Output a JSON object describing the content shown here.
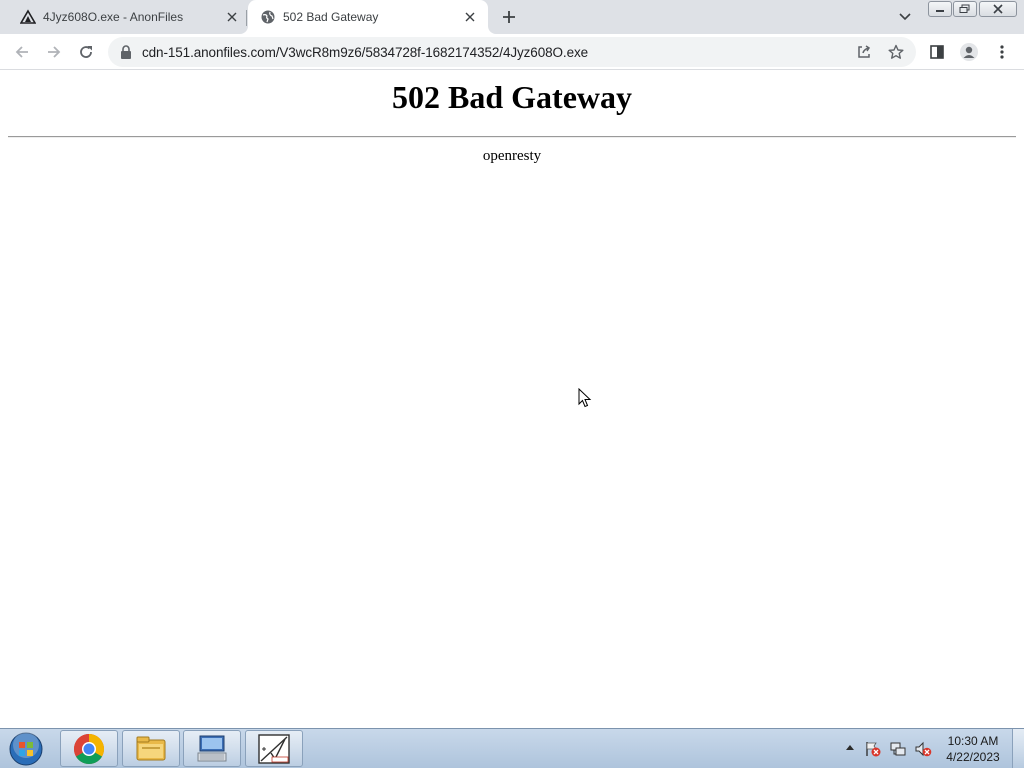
{
  "browser": {
    "tabs": [
      {
        "title": "4Jyz608O.exe - AnonFiles",
        "favicon": "anonfiles-logo-icon",
        "active": false
      },
      {
        "title": "502 Bad Gateway",
        "favicon": "globe-icon",
        "active": true
      }
    ],
    "address_bar": {
      "url": "cdn-151.anonfiles.com/V3wcR8m9z6/5834728f-1682174352/4Jyz608O.exe"
    }
  },
  "page": {
    "title": "502 Bad Gateway",
    "server": "openresty"
  },
  "taskbar": {
    "pinned": [
      "chrome-icon",
      "file-explorer-icon",
      "remote-desktop-icon",
      "app-icon"
    ],
    "clock": {
      "time": "10:30 AM",
      "date": "4/22/2023"
    }
  },
  "colors": {
    "tabstrip_bg": "#dee1e6",
    "omnibox_bg": "#f1f3f4",
    "taskbar_bg": "#aec4dc"
  }
}
